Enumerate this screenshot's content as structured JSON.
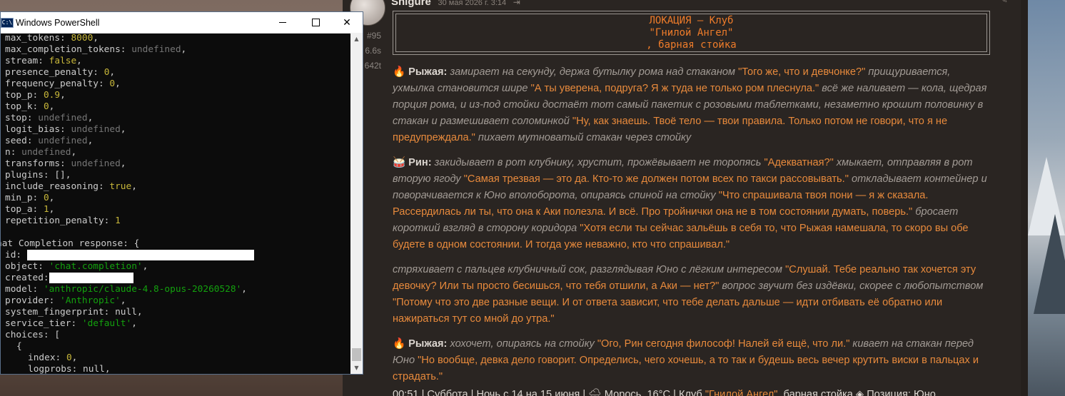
{
  "powershell": {
    "title": "Windows PowerShell",
    "icon_text": "C:\\",
    "lines": [
      [
        {
          "t": "max_tokens: "
        },
        {
          "t": "8000",
          "c": "num"
        },
        {
          "t": ","
        }
      ],
      [
        {
          "t": "max_completion_tokens: "
        },
        {
          "t": "undefined",
          "c": "undef"
        },
        {
          "t": ","
        }
      ],
      [
        {
          "t": "stream: "
        },
        {
          "t": "false",
          "c": "bool"
        },
        {
          "t": ","
        }
      ],
      [
        {
          "t": "presence_penalty: "
        },
        {
          "t": "0",
          "c": "num"
        },
        {
          "t": ","
        }
      ],
      [
        {
          "t": "frequency_penalty: "
        },
        {
          "t": "0",
          "c": "num"
        },
        {
          "t": ","
        }
      ],
      [
        {
          "t": "top_p: "
        },
        {
          "t": "0.9",
          "c": "num"
        },
        {
          "t": ","
        }
      ],
      [
        {
          "t": "top_k: "
        },
        {
          "t": "0",
          "c": "num"
        },
        {
          "t": ","
        }
      ],
      [
        {
          "t": "stop: "
        },
        {
          "t": "undefined",
          "c": "undef"
        },
        {
          "t": ","
        }
      ],
      [
        {
          "t": "logit_bias: "
        },
        {
          "t": "undefined",
          "c": "undef"
        },
        {
          "t": ","
        }
      ],
      [
        {
          "t": "seed: "
        },
        {
          "t": "undefined",
          "c": "undef"
        },
        {
          "t": ","
        }
      ],
      [
        {
          "t": "n: "
        },
        {
          "t": "undefined",
          "c": "undef"
        },
        {
          "t": ","
        }
      ],
      [
        {
          "t": "transforms: "
        },
        {
          "t": "undefined",
          "c": "undef"
        },
        {
          "t": ","
        }
      ],
      [
        {
          "t": "plugins: [],"
        }
      ],
      [
        {
          "t": "include_reasoning: "
        },
        {
          "t": "true",
          "c": "bool"
        },
        {
          "t": ","
        }
      ],
      [
        {
          "t": "min_p: "
        },
        {
          "t": "0",
          "c": "num"
        },
        {
          "t": ","
        }
      ],
      [
        {
          "t": "top_a: "
        },
        {
          "t": "1",
          "c": "num"
        },
        {
          "t": ","
        }
      ],
      [
        {
          "t": "repetition_penalty: "
        },
        {
          "t": "1",
          "c": "num"
        }
      ],
      [],
      [
        {
          "t": "hat Completion response: {",
          "indent": "outdent"
        }
      ],
      [
        {
          "t": "id: "
        },
        {
          "redact": 318
        }
      ],
      [
        {
          "t": "object: "
        },
        {
          "t": "'chat.completion'",
          "c": "str"
        },
        {
          "t": ","
        }
      ],
      [
        {
          "t": "created:"
        },
        {
          "redact": 118
        }
      ],
      [
        {
          "t": "model: "
        },
        {
          "t": "'anthropic/claude-4.8-opus-20260528'",
          "c": "str"
        },
        {
          "t": ","
        }
      ],
      [
        {
          "t": "provider: "
        },
        {
          "t": "'Anthropic'",
          "c": "str"
        },
        {
          "t": ","
        }
      ],
      [
        {
          "t": "system_fingerprint: null,"
        }
      ],
      [
        {
          "t": "service_tier: "
        },
        {
          "t": "'default'",
          "c": "str"
        },
        {
          "t": ","
        }
      ],
      [
        {
          "t": "choices: ["
        }
      ],
      [
        {
          "t": "{",
          "indent": "nest1"
        }
      ],
      [
        {
          "t": "index: ",
          "indent": "nest2"
        },
        {
          "t": "0",
          "c": "num"
        },
        {
          "t": ","
        }
      ],
      [
        {
          "t": "logprobs: null,",
          "indent": "nest2"
        }
      ]
    ]
  },
  "chat": {
    "author": "Shigure",
    "timestamp": "30 мая 2026 г. 3:14",
    "stats": [
      "#95",
      "6.6s",
      "642t"
    ],
    "location": [
      "ЛОКАЦИЯ – Клуб",
      "\"Гнилой Ангел\"",
      ", барная стойка"
    ],
    "paragraphs": [
      [
        {
          "k": "emoji",
          "t": "🔥"
        },
        {
          "k": "speaker",
          "t": "Рыжая:"
        },
        {
          "k": "action",
          "t": " замирает на секунду, держа бутылку рома над стаканом "
        },
        {
          "k": "quote",
          "t": "\"Того же, что и девчонке?\""
        },
        {
          "k": "action",
          "t": " прищуривается, ухмылка становится шире "
        },
        {
          "k": "quote",
          "t": "\"А ты уверена, подруга? Я ж туда не только ром плеснула.\""
        },
        {
          "k": "action",
          "t": " всё же наливает — кола, щедрая порция рома, и из-под стойки достаёт тот самый пакетик с розовыми таблетками, незаметно крошит половинку в стакан и размешивает соломинкой "
        },
        {
          "k": "quote",
          "t": "\"Ну, как знаешь. Твоё тело — твои правила. Только потом не говори, что я не предупреждала.\""
        },
        {
          "k": "action",
          "t": " пихает мутноватый стакан через стойку"
        }
      ],
      [
        {
          "k": "emoji",
          "t": "🥁"
        },
        {
          "k": "speaker",
          "t": "Рин:"
        },
        {
          "k": "action",
          "t": " закидывает в рот клубнику, хрустит, прожёвывает не торопясь "
        },
        {
          "k": "quote",
          "t": "\"Адекватная?\""
        },
        {
          "k": "action",
          "t": " хмыкает, отправляя в рот вторую ягоду "
        },
        {
          "k": "quote",
          "t": "\"Самая трезвая — это да. Кто-то же должен потом всех по такси рассовывать.\""
        },
        {
          "k": "action",
          "t": " откладывает контейнер и поворачивается к Юно вполоборота, опираясь спиной на стойку "
        },
        {
          "k": "quote",
          "t": "\"Что спрашивала твоя пони — я ж сказала. Рассердилась ли ты, что она к Аки полезла. И всё. Про тройнички она не в том состоянии думать, поверь.\""
        },
        {
          "k": "action",
          "t": " бросает короткий взгляд в сторону коридора "
        },
        {
          "k": "quote",
          "t": "\"Хотя если ты сейчас зальёшь в себя то, что Рыжая намешала, то скоро вы обе будете в одном состоянии. И тогда уже неважно, кто что спрашивал.\""
        }
      ],
      [
        {
          "k": "action",
          "t": "стряхивает с пальцев клубничный сок, разглядывая Юно с лёгким интересом "
        },
        {
          "k": "quote",
          "t": "\"Слушай. Тебе реально так хочется эту девочку? Или ты просто бесишься, что тебя отшили, а Аки — нет?\""
        },
        {
          "k": "action",
          "t": " вопрос звучит без издёвки, скорее с любопытством "
        },
        {
          "k": "quote",
          "t": "\"Потому что это две разные вещи. И от ответа зависит, что тебе делать дальше — идти отбивать её обратно или нажираться тут со мной до утра.\""
        }
      ],
      [
        {
          "k": "emoji",
          "t": "🔥"
        },
        {
          "k": "speaker",
          "t": "Рыжая:"
        },
        {
          "k": "action",
          "t": " хохочет, опираясь на стойку "
        },
        {
          "k": "quote",
          "t": "\"Ого, Рин сегодня философ! Налей ей ещё, что ли.\""
        },
        {
          "k": "action",
          "t": " кивает на стакан перед Юно "
        },
        {
          "k": "quote",
          "t": "\"Но вообще, девка дело говорит. Определись, чего хочешь, а то так и будешь весь вечер крутить виски в пальцах и страдать.\""
        }
      ]
    ],
    "status_line": {
      "prefix": "00:51 | Суббота | Ночь с 14 на 15 июня | 🌧 Морось, 16°C | Клуб ",
      "club": "\"Гнилой Ангел\"",
      "suffix": ", барная стойка ◈ Позиция: Юно"
    }
  }
}
